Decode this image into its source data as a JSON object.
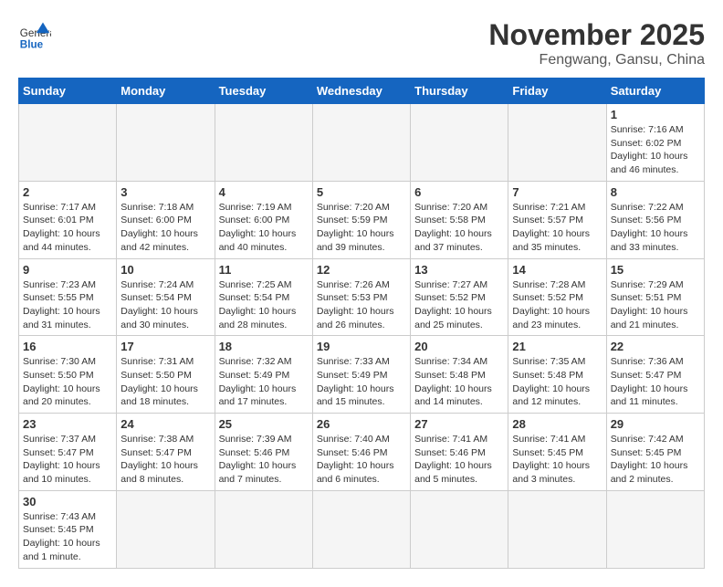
{
  "header": {
    "logo_general": "General",
    "logo_blue": "Blue",
    "month_title": "November 2025",
    "location": "Fengwang, Gansu, China"
  },
  "weekdays": [
    "Sunday",
    "Monday",
    "Tuesday",
    "Wednesday",
    "Thursday",
    "Friday",
    "Saturday"
  ],
  "weeks": [
    [
      {
        "day": "",
        "info": ""
      },
      {
        "day": "",
        "info": ""
      },
      {
        "day": "",
        "info": ""
      },
      {
        "day": "",
        "info": ""
      },
      {
        "day": "",
        "info": ""
      },
      {
        "day": "",
        "info": ""
      },
      {
        "day": "1",
        "info": "Sunrise: 7:16 AM\nSunset: 6:02 PM\nDaylight: 10 hours\nand 46 minutes."
      }
    ],
    [
      {
        "day": "2",
        "info": "Sunrise: 7:17 AM\nSunset: 6:01 PM\nDaylight: 10 hours\nand 44 minutes."
      },
      {
        "day": "3",
        "info": "Sunrise: 7:18 AM\nSunset: 6:00 PM\nDaylight: 10 hours\nand 42 minutes."
      },
      {
        "day": "4",
        "info": "Sunrise: 7:19 AM\nSunset: 6:00 PM\nDaylight: 10 hours\nand 40 minutes."
      },
      {
        "day": "5",
        "info": "Sunrise: 7:20 AM\nSunset: 5:59 PM\nDaylight: 10 hours\nand 39 minutes."
      },
      {
        "day": "6",
        "info": "Sunrise: 7:20 AM\nSunset: 5:58 PM\nDaylight: 10 hours\nand 37 minutes."
      },
      {
        "day": "7",
        "info": "Sunrise: 7:21 AM\nSunset: 5:57 PM\nDaylight: 10 hours\nand 35 minutes."
      },
      {
        "day": "8",
        "info": "Sunrise: 7:22 AM\nSunset: 5:56 PM\nDaylight: 10 hours\nand 33 minutes."
      }
    ],
    [
      {
        "day": "9",
        "info": "Sunrise: 7:23 AM\nSunset: 5:55 PM\nDaylight: 10 hours\nand 31 minutes."
      },
      {
        "day": "10",
        "info": "Sunrise: 7:24 AM\nSunset: 5:54 PM\nDaylight: 10 hours\nand 30 minutes."
      },
      {
        "day": "11",
        "info": "Sunrise: 7:25 AM\nSunset: 5:54 PM\nDaylight: 10 hours\nand 28 minutes."
      },
      {
        "day": "12",
        "info": "Sunrise: 7:26 AM\nSunset: 5:53 PM\nDaylight: 10 hours\nand 26 minutes."
      },
      {
        "day": "13",
        "info": "Sunrise: 7:27 AM\nSunset: 5:52 PM\nDaylight: 10 hours\nand 25 minutes."
      },
      {
        "day": "14",
        "info": "Sunrise: 7:28 AM\nSunset: 5:52 PM\nDaylight: 10 hours\nand 23 minutes."
      },
      {
        "day": "15",
        "info": "Sunrise: 7:29 AM\nSunset: 5:51 PM\nDaylight: 10 hours\nand 21 minutes."
      }
    ],
    [
      {
        "day": "16",
        "info": "Sunrise: 7:30 AM\nSunset: 5:50 PM\nDaylight: 10 hours\nand 20 minutes."
      },
      {
        "day": "17",
        "info": "Sunrise: 7:31 AM\nSunset: 5:50 PM\nDaylight: 10 hours\nand 18 minutes."
      },
      {
        "day": "18",
        "info": "Sunrise: 7:32 AM\nSunset: 5:49 PM\nDaylight: 10 hours\nand 17 minutes."
      },
      {
        "day": "19",
        "info": "Sunrise: 7:33 AM\nSunset: 5:49 PM\nDaylight: 10 hours\nand 15 minutes."
      },
      {
        "day": "20",
        "info": "Sunrise: 7:34 AM\nSunset: 5:48 PM\nDaylight: 10 hours\nand 14 minutes."
      },
      {
        "day": "21",
        "info": "Sunrise: 7:35 AM\nSunset: 5:48 PM\nDaylight: 10 hours\nand 12 minutes."
      },
      {
        "day": "22",
        "info": "Sunrise: 7:36 AM\nSunset: 5:47 PM\nDaylight: 10 hours\nand 11 minutes."
      }
    ],
    [
      {
        "day": "23",
        "info": "Sunrise: 7:37 AM\nSunset: 5:47 PM\nDaylight: 10 hours\nand 10 minutes."
      },
      {
        "day": "24",
        "info": "Sunrise: 7:38 AM\nSunset: 5:47 PM\nDaylight: 10 hours\nand 8 minutes."
      },
      {
        "day": "25",
        "info": "Sunrise: 7:39 AM\nSunset: 5:46 PM\nDaylight: 10 hours\nand 7 minutes."
      },
      {
        "day": "26",
        "info": "Sunrise: 7:40 AM\nSunset: 5:46 PM\nDaylight: 10 hours\nand 6 minutes."
      },
      {
        "day": "27",
        "info": "Sunrise: 7:41 AM\nSunset: 5:46 PM\nDaylight: 10 hours\nand 5 minutes."
      },
      {
        "day": "28",
        "info": "Sunrise: 7:41 AM\nSunset: 5:45 PM\nDaylight: 10 hours\nand 3 minutes."
      },
      {
        "day": "29",
        "info": "Sunrise: 7:42 AM\nSunset: 5:45 PM\nDaylight: 10 hours\nand 2 minutes."
      }
    ],
    [
      {
        "day": "30",
        "info": "Sunrise: 7:43 AM\nSunset: 5:45 PM\nDaylight: 10 hours\nand 1 minute."
      },
      {
        "day": "",
        "info": ""
      },
      {
        "day": "",
        "info": ""
      },
      {
        "day": "",
        "info": ""
      },
      {
        "day": "",
        "info": ""
      },
      {
        "day": "",
        "info": ""
      },
      {
        "day": "",
        "info": ""
      }
    ]
  ]
}
